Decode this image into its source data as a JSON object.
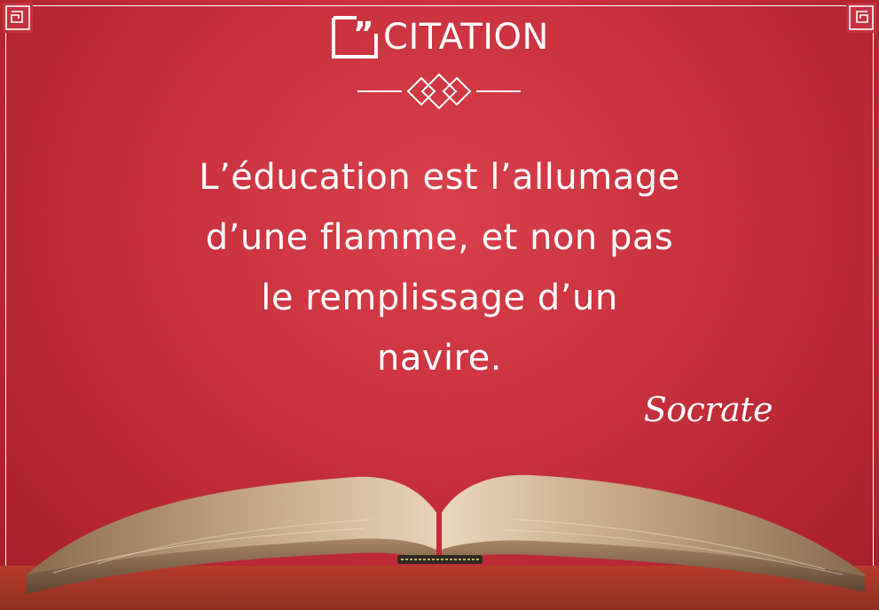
{
  "brand": {
    "name": "CITATION",
    "logo_icon": "quote-frame-icon",
    "color": "#ffffff"
  },
  "quote": {
    "lines": [
      "L’éducation est l’allumage",
      "d’une flamme, et non pas",
      "le remplissage d’un",
      "navire."
    ],
    "author": "Socrate"
  },
  "colors": {
    "background": "#c8303e",
    "text": "#ffffff"
  },
  "icons": {
    "corners": "corner-ornament-icon",
    "divider": "diamond-divider-icon",
    "image": "open-book-image"
  }
}
